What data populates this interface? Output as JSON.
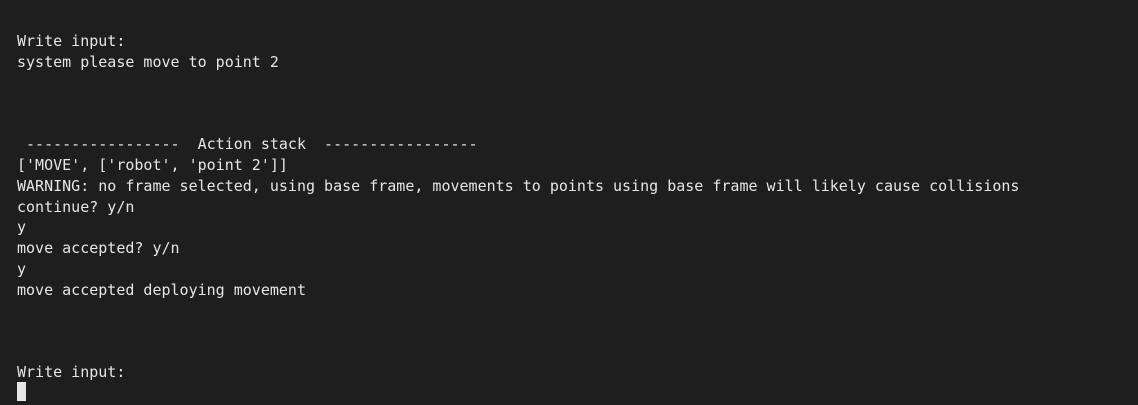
{
  "terminal": {
    "lines": [
      "Write input:",
      "system please move to point 2",
      " -----------------  Action stack  -----------------",
      "['MOVE', ['robot', 'point 2']]",
      "WARNING: no frame selected, using base frame, movements to points using base frame will likely cause collisions",
      "continue? y/n",
      "y",
      "move accepted? y/n",
      "y",
      "move accepted deploying movement",
      "Write input:"
    ]
  }
}
